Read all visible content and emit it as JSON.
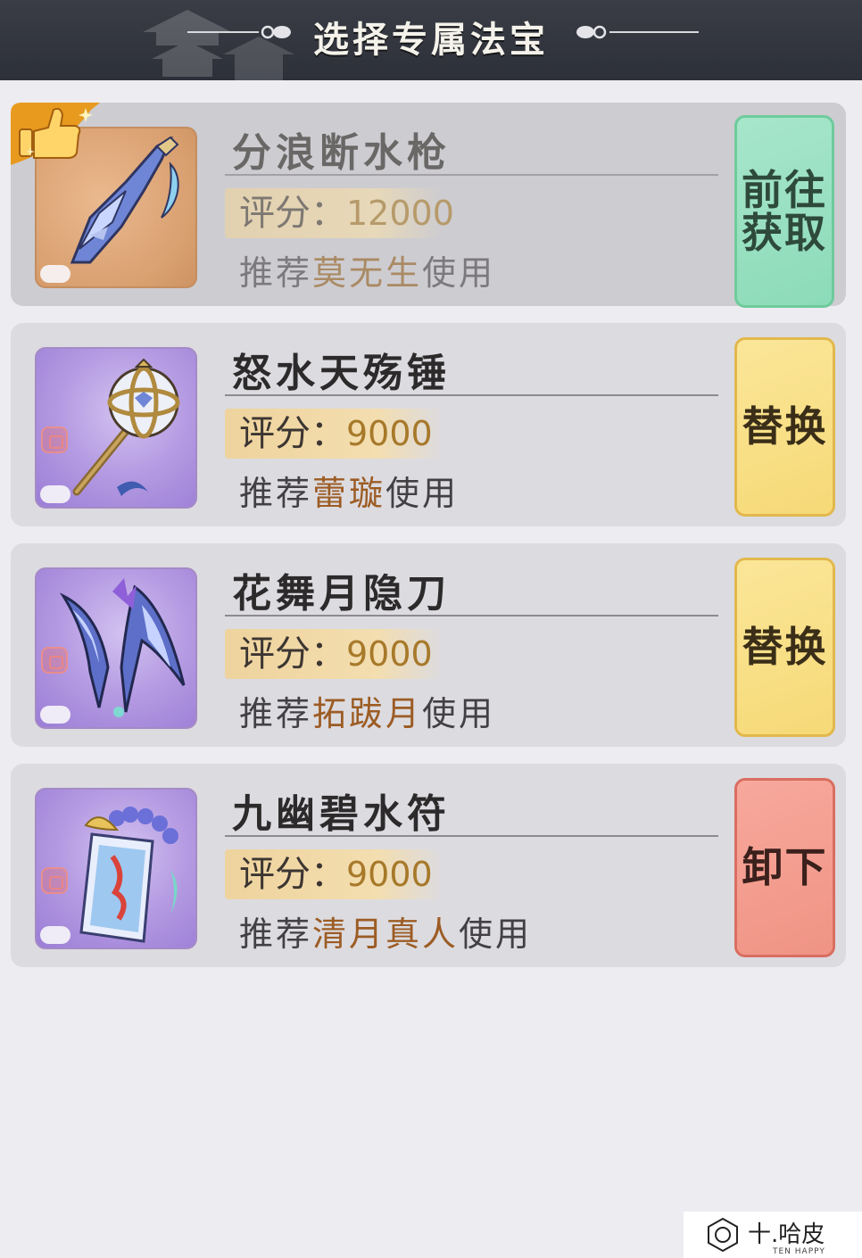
{
  "header": {
    "title": "选择专属法宝"
  },
  "treasures": [
    {
      "name": "分浪断水枪",
      "score_label": "评分：",
      "score": "12000",
      "rec_prefix": "推荐",
      "rec_name": "莫无生",
      "rec_suffix": "使用",
      "action": "前往获取",
      "action_lines": [
        "前往",
        "获取"
      ],
      "thumb_icon": "spear-icon",
      "badge": "thumbs-up-icon"
    },
    {
      "name": "怒水天殇锤",
      "score_label": "评分：",
      "score": "9000",
      "rec_prefix": "推荐",
      "rec_name": "蕾璇",
      "rec_suffix": "使用",
      "action": "替换",
      "thumb_icon": "hammer-icon"
    },
    {
      "name": "花舞月隐刀",
      "score_label": "评分：",
      "score": "9000",
      "rec_prefix": "推荐",
      "rec_name": "拓跋月",
      "rec_suffix": "使用",
      "action": "替换",
      "thumb_icon": "twin-blades-icon"
    },
    {
      "name": "九幽碧水符",
      "score_label": "评分：",
      "score": "9000",
      "rec_prefix": "推荐",
      "rec_name": "清月真人",
      "rec_suffix": "使用",
      "action": "卸下",
      "thumb_icon": "talisman-icon"
    }
  ],
  "watermark": {
    "brand": "十.哈皮",
    "sub": "TEN HAPPY",
    "logo": "hexagon-logo-icon"
  },
  "colors": {
    "header_bg": "#2d3039",
    "get_button": "#8cdbb8",
    "replace_button": "#f6d977",
    "unequip_button": "#f09485",
    "score_value": "#a7792a",
    "recommend_name": "#9c5c24"
  }
}
